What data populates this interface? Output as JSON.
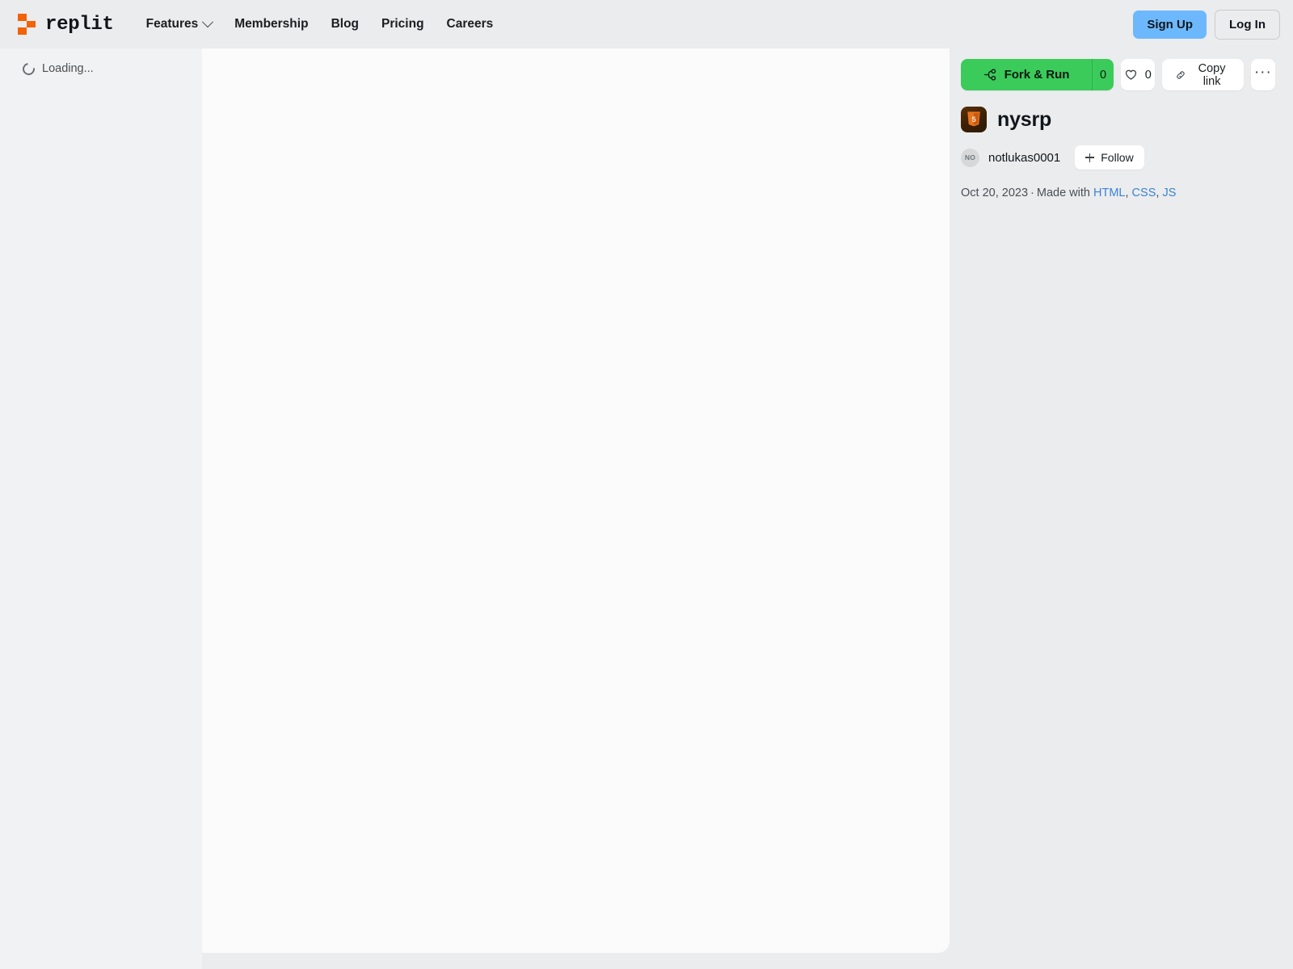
{
  "nav": {
    "brand_word": "replit",
    "brand_icon": "replit-logo-blocks",
    "links": [
      {
        "label": "Features",
        "has_chevron": true
      },
      {
        "label": "Membership",
        "has_chevron": false
      },
      {
        "label": "Blog",
        "has_chevron": false
      },
      {
        "label": "Pricing",
        "has_chevron": false
      },
      {
        "label": "Careers",
        "has_chevron": false
      }
    ],
    "signup_label": "Sign Up",
    "login_label": "Log In",
    "signup_color": "#6DB8FC"
  },
  "sidebar": {
    "loading_label": "Loading...",
    "spinner_icon": "spinner-icon"
  },
  "preview": {
    "background": "#FBFBFC"
  },
  "actions": {
    "fork_label": "Fork & Run",
    "fork_icon": "fork-icon",
    "fork_count": "0",
    "fork_color": "#3BCB5B",
    "likes_icon": "heart-icon",
    "likes_count": "0",
    "copy_icon": "link-icon",
    "copy_label": "Copy link",
    "more_label": "···",
    "more_icon": "ellipsis-icon"
  },
  "repl": {
    "icon": "html5-icon",
    "icon_glyph": "5",
    "title": "nysrp",
    "author_initials": "NO",
    "author_name": "notlukas0001",
    "follow_label": "Follow",
    "follow_icon": "plus-icon",
    "date": "Oct 20, 2023",
    "separator": "·",
    "made_with_label": "Made with",
    "languages": [
      {
        "label": "HTML"
      },
      {
        "label": "CSS"
      },
      {
        "label": "JS"
      }
    ],
    "language_link_color": "#3B82D6"
  }
}
